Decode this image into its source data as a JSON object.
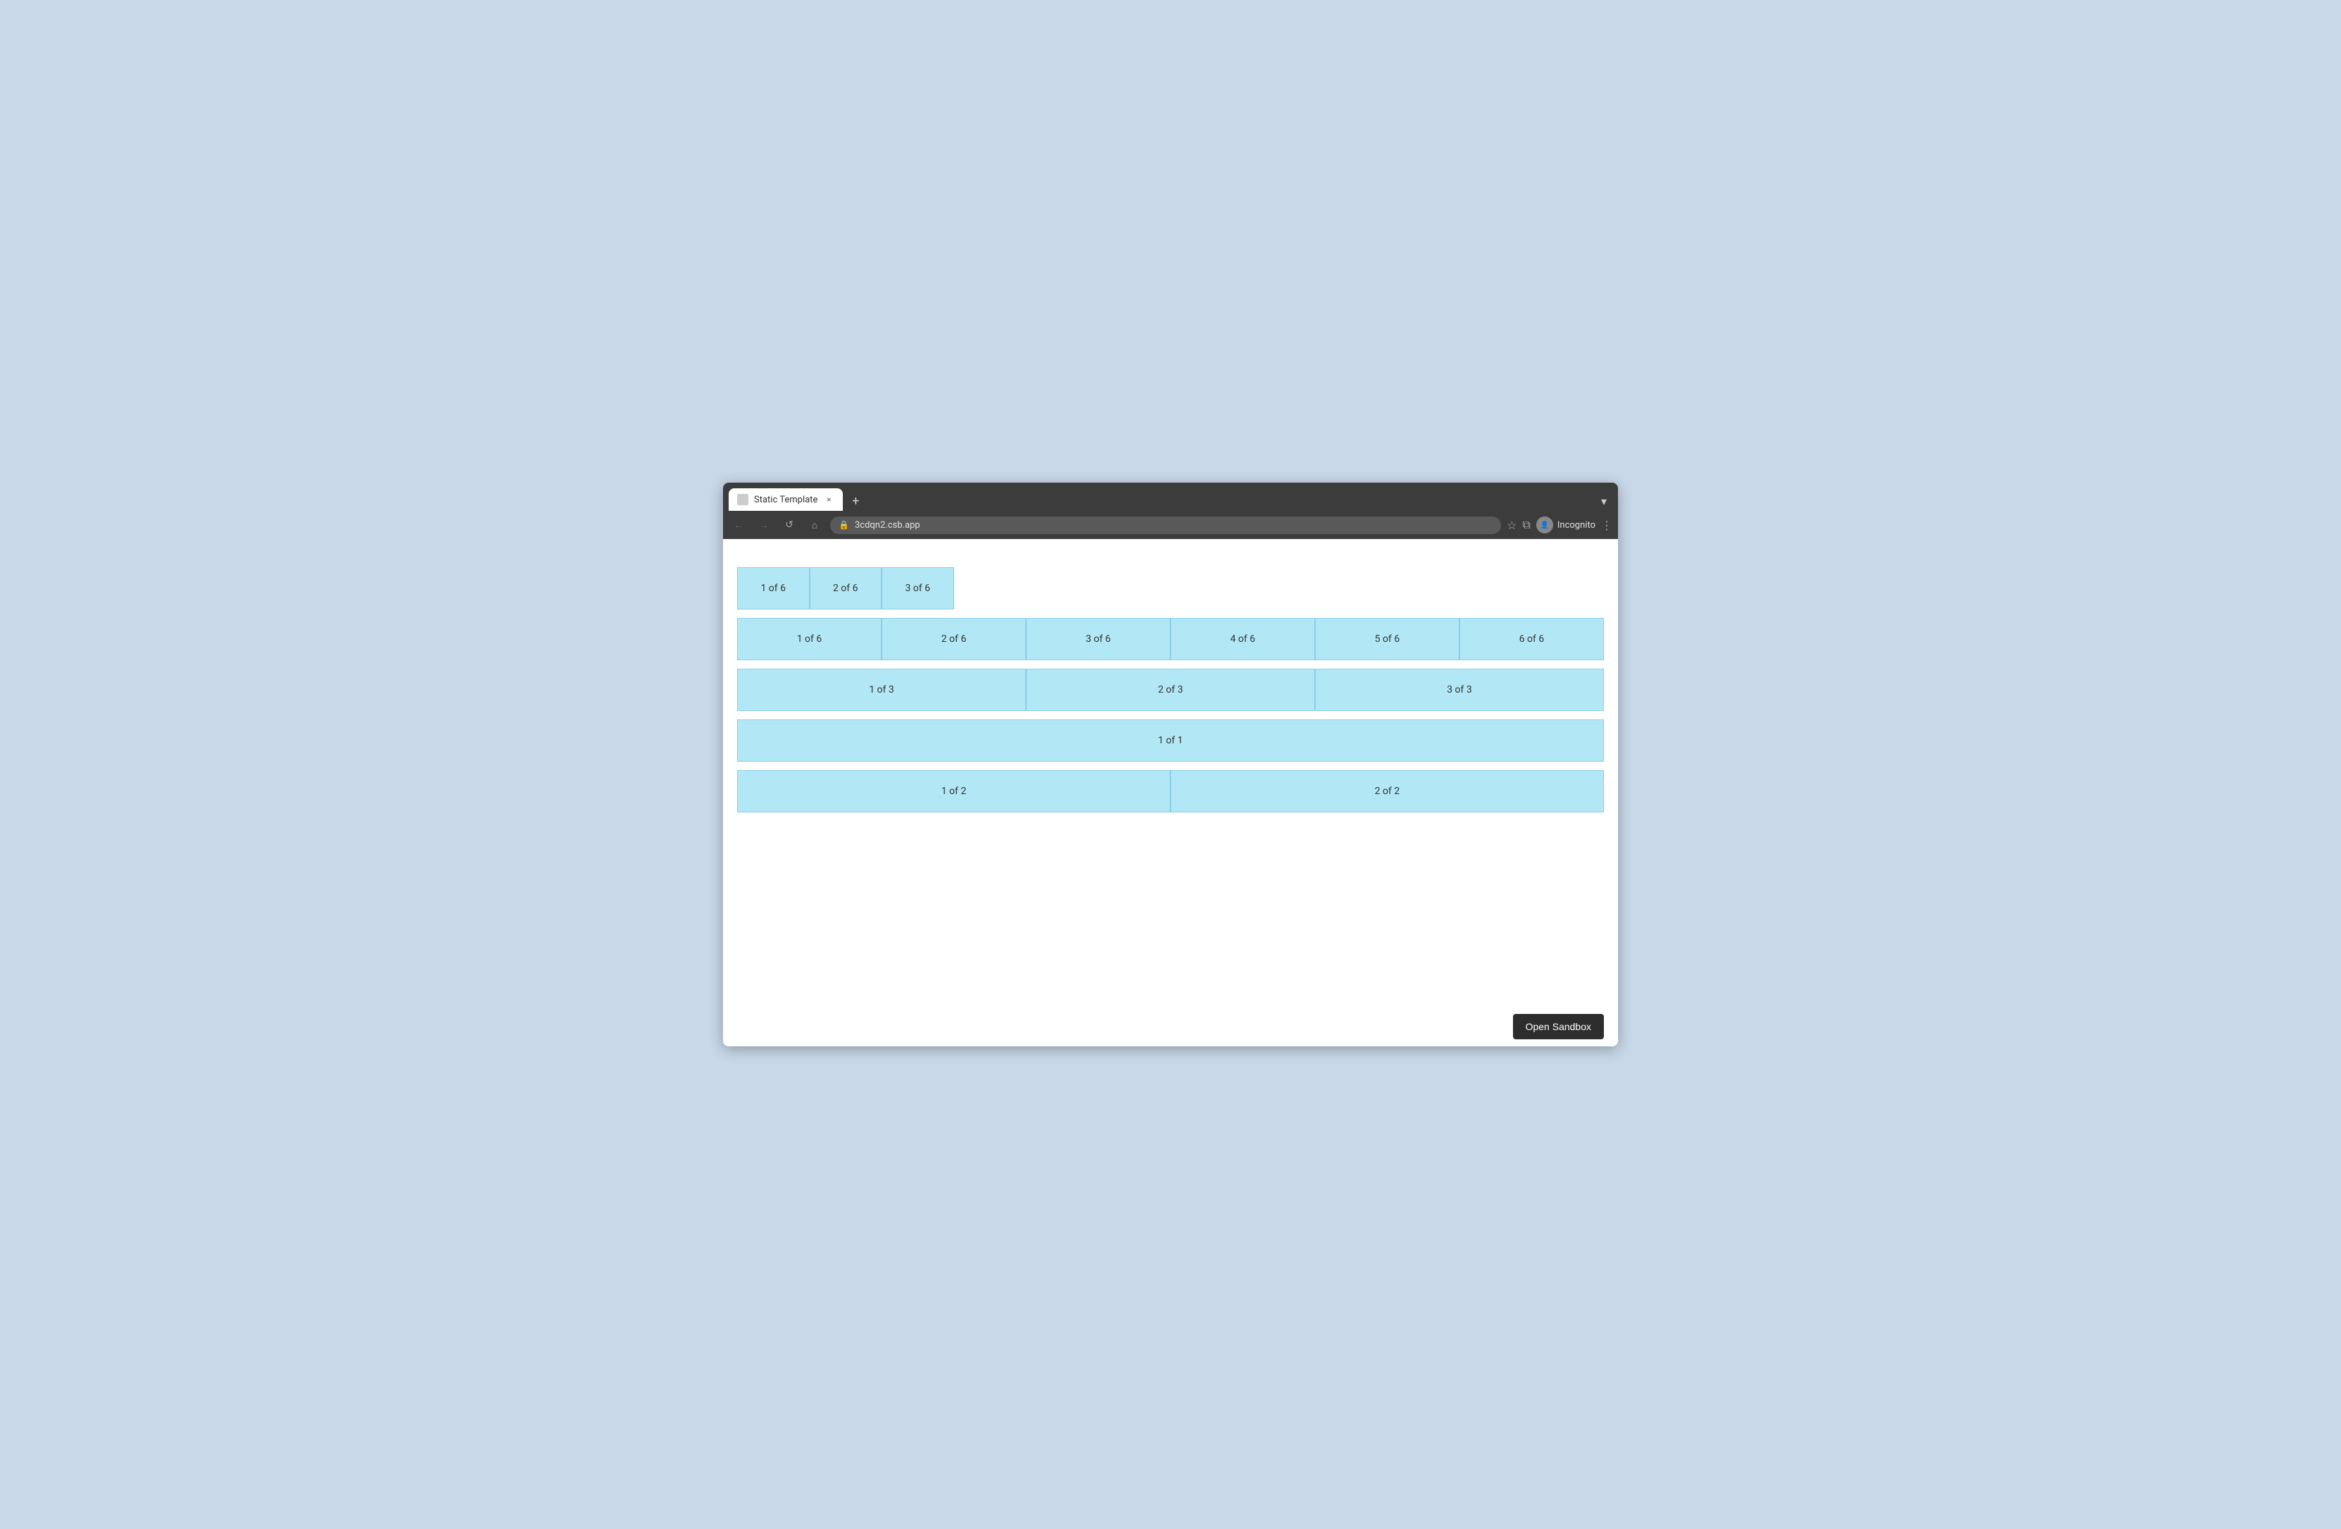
{
  "browser": {
    "tab": {
      "label": "Static Template",
      "close_label": "×"
    },
    "new_tab_label": "+",
    "tab_dropdown_label": "▾",
    "nav": {
      "back_label": "←",
      "forward_label": "→",
      "reload_label": "↺",
      "home_label": "⌂"
    },
    "url": "3cdqn2.csb.app",
    "lock_icon": "🔒",
    "star_label": "☆",
    "split_label": "⧉",
    "profile_label": "Incognito",
    "menu_label": "⋮"
  },
  "rows": [
    {
      "id": "row-partial",
      "cells": [
        "1 of 6",
        "2 of 6",
        "3 of 6"
      ]
    },
    {
      "id": "row-6",
      "cells": [
        "1 of 6",
        "2 of 6",
        "3 of 6",
        "4 of 6",
        "5 of 6",
        "6 of 6"
      ]
    },
    {
      "id": "row-3",
      "cells": [
        "1 of 3",
        "2 of 3",
        "3 of 3"
      ]
    },
    {
      "id": "row-1",
      "cells": [
        "1 of 1"
      ]
    },
    {
      "id": "row-2",
      "cells": [
        "1 of 2",
        "2 of 2"
      ]
    }
  ],
  "sandbox_button_label": "Open Sandbox"
}
